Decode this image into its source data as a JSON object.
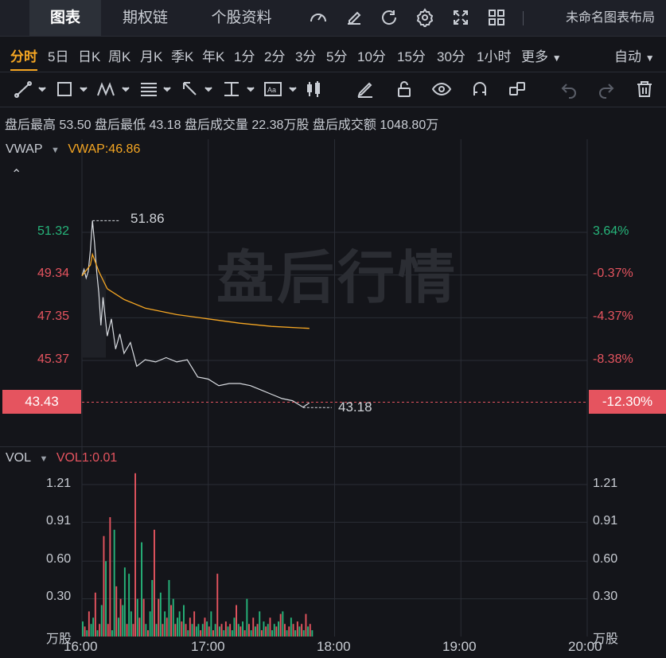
{
  "header": {
    "tabs": [
      "图表",
      "期权链",
      "个股资料"
    ],
    "active_tab": 0,
    "icons": [
      "gauge-icon",
      "edit-icon",
      "refresh-icon",
      "settings-icon",
      "fullscreen-icon",
      "grid-icon"
    ],
    "layout_label": "未命名图表布局"
  },
  "periods": {
    "items": [
      "分时",
      "5日",
      "日K",
      "周K",
      "月K",
      "季K",
      "年K",
      "1分",
      "2分",
      "3分",
      "5分",
      "10分",
      "15分",
      "30分",
      "1小时",
      "更多"
    ],
    "active": "分时",
    "mode_label": "自动"
  },
  "tools": [
    "line-tool-icon",
    "rect-tool-icon",
    "pattern-tool-icon",
    "fib-tool-icon",
    "arrow-tool-icon",
    "measure-tool-icon",
    "text-tool-icon",
    "candle-tool-icon",
    "pen-icon",
    "unlock-icon",
    "eye-icon",
    "magnet-icon",
    "group-icon",
    "undo-icon",
    "redo-icon",
    "trash-icon"
  ],
  "info": {
    "high_label": "盘后最高",
    "high_value": "53.50",
    "low_label": "盘后最低",
    "low_value": "43.18",
    "vol_label": "盘后成交量",
    "vol_value": "22.38万股",
    "amt_label": "盘后成交额",
    "amt_value": "1048.80万"
  },
  "price_panel": {
    "indicator": "VWAP",
    "indicator_value": "VWAP:46.86",
    "watermark": "盘后行情",
    "y_left": [
      "51.32",
      "49.34",
      "47.35",
      "45.37"
    ],
    "y_right": [
      "3.64%",
      "-0.37%",
      "-4.37%",
      "-8.38%"
    ],
    "current_price": "43.43",
    "current_pct": "-12.30%",
    "max_label": "51.86",
    "min_label": "43.18"
  },
  "volume_panel": {
    "indicator": "VOL",
    "indicator_value": "VOL1:0.01",
    "y": [
      "1.21",
      "0.91",
      "0.60",
      "0.30"
    ],
    "unit": "万股"
  },
  "x_axis": [
    "16:00",
    "17:00",
    "18:00",
    "19:00",
    "20:00"
  ],
  "colors": {
    "up": "#26b47a",
    "down": "#e5545f",
    "vwap": "#f5a623",
    "accent": "#f5a623",
    "bg": "#14151a"
  },
  "chart_data": {
    "type": "line",
    "series": [
      {
        "name": "price",
        "x": [
          "16:00",
          "16:01",
          "16:02",
          "16:03",
          "16:04",
          "16:05",
          "16:06",
          "16:07",
          "16:08",
          "16:09",
          "16:10",
          "16:12",
          "16:14",
          "16:16",
          "16:18",
          "16:20",
          "16:23",
          "16:26",
          "16:30",
          "16:35",
          "16:40",
          "16:45",
          "16:50",
          "16:55",
          "17:00",
          "17:05",
          "17:10",
          "17:15",
          "17:20",
          "17:25",
          "17:30",
          "17:35",
          "17:40",
          "17:45",
          "17:48"
        ],
        "values": [
          49.3,
          49.6,
          49.2,
          49.5,
          50.5,
          51.86,
          50.8,
          49.5,
          48.5,
          47.0,
          48.3,
          46.5,
          47.3,
          45.9,
          46.6,
          45.7,
          46.2,
          45.1,
          45.4,
          45.3,
          45.5,
          45.3,
          45.4,
          44.6,
          44.5,
          44.2,
          44.3,
          44.3,
          44.2,
          44.0,
          43.8,
          43.6,
          43.5,
          43.2,
          43.4
        ]
      },
      {
        "name": "VWAP",
        "x": [
          "16:00",
          "16:04",
          "16:05",
          "16:08",
          "16:12",
          "16:20",
          "16:30",
          "16:45",
          "17:00",
          "17:15",
          "17:30",
          "17:48"
        ],
        "values": [
          49.3,
          49.8,
          50.3,
          49.5,
          48.7,
          48.2,
          47.8,
          47.5,
          47.3,
          47.1,
          46.95,
          46.86
        ]
      }
    ],
    "volume": {
      "x_start": "16:00",
      "x_step_min": 1,
      "values": [
        0.12,
        0.08,
        0.05,
        0.2,
        0.1,
        0.15,
        0.35,
        0.05,
        0.1,
        0.25,
        0.8,
        0.6,
        0.1,
        0.95,
        0.05,
        0.85,
        0.4,
        0.15,
        0.3,
        0.25,
        0.55,
        0.1,
        0.5,
        0.2,
        0.1,
        1.3,
        0.3,
        0.15,
        0.75,
        0.3,
        0.1,
        0.05,
        0.2,
        0.45,
        0.85,
        0.1,
        0.3,
        0.35,
        0.1,
        0.2,
        0.15,
        0.45,
        0.25,
        0.3,
        0.1,
        0.15,
        0.2,
        0.12,
        0.25,
        0.1,
        0.05,
        0.15,
        0.1,
        0.2,
        0.08,
        0.1,
        0.05,
        0.1,
        0.15,
        0.12,
        0.08,
        0.2,
        0.05,
        0.1,
        0.5,
        0.08,
        0.1,
        0.05,
        0.12,
        0.08,
        0.1,
        0.05,
        0.15,
        0.25,
        0.1,
        0.08,
        0.12,
        0.05,
        0.3,
        0.1,
        0.05,
        0.15,
        0.08,
        0.1,
        0.2,
        0.05,
        0.12,
        0.08,
        0.1,
        0.15,
        0.05,
        0.1,
        0.08,
        0.12,
        0.18,
        0.2,
        0.1,
        0.05,
        0.08,
        0.15,
        0.1,
        0.05,
        0.12,
        0.08,
        0.1,
        0.05,
        0.18,
        0.08,
        0.1,
        0.05
      ],
      "colors": [
        "up",
        "down",
        "up",
        "down",
        "up",
        "up",
        "down",
        "up",
        "down",
        "up",
        "down",
        "up",
        "down",
        "down",
        "up",
        "up",
        "down",
        "up",
        "down",
        "up",
        "up",
        "down",
        "up",
        "up",
        "down",
        "down",
        "up",
        "down",
        "up",
        "down",
        "up",
        "down",
        "up",
        "up",
        "down",
        "up",
        "down",
        "up",
        "down",
        "up",
        "down",
        "up",
        "down",
        "up",
        "down",
        "up",
        "up",
        "down",
        "up",
        "down",
        "up",
        "down",
        "up",
        "down",
        "up",
        "up",
        "down",
        "up",
        "down",
        "up",
        "down",
        "up",
        "down",
        "up",
        "down",
        "up",
        "down",
        "up",
        "down",
        "up",
        "down",
        "up",
        "up",
        "down",
        "up",
        "down",
        "up",
        "down",
        "up",
        "down",
        "up",
        "down",
        "up",
        "down",
        "up",
        "down",
        "up",
        "down",
        "up",
        "down",
        "up",
        "up",
        "down",
        "up",
        "down",
        "up",
        "down",
        "up",
        "down",
        "up",
        "down",
        "up",
        "down",
        "up",
        "down",
        "up",
        "down",
        "up",
        "down",
        "up"
      ]
    },
    "ylim_price": [
      42.0,
      53.5
    ],
    "ylim_volume": [
      0,
      1.45
    ],
    "xlim": [
      "16:00",
      "20:00"
    ],
    "grid": true
  }
}
